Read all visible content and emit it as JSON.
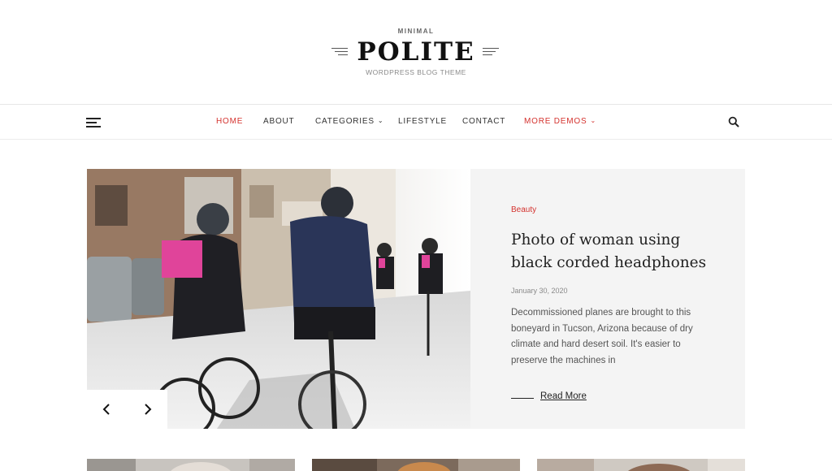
{
  "site": {
    "tagline": "MINIMAL",
    "title": "POLITE",
    "subtitle": "WORDPRESS BLOG THEME"
  },
  "nav": {
    "items": [
      {
        "label": "HOME",
        "active": true
      },
      {
        "label": "ABOUT"
      },
      {
        "label": "CATEGORIES",
        "dropdown": true
      },
      {
        "label": "LIFESTYLE"
      },
      {
        "label": "CONTACT"
      },
      {
        "label": "MORE DEMOS",
        "dropdown": true
      }
    ],
    "menu_icon": "hamburger-icon",
    "search_icon": "search-icon"
  },
  "featured": {
    "category": "Beauty",
    "title": "Photo of woman using black corded headphones",
    "date": "January 30, 2020",
    "excerpt": "Decommissioned planes are brought to this boneyard in Tucson, Arizona because of dry climate and hard desert soil. It's easier to preserve the machines in",
    "read_more": "Read More",
    "image_icon": "cyclists-photo",
    "prev_icon": "chevron-left-icon",
    "next_icon": "chevron-right-icon"
  },
  "colors": {
    "accent": "#d4322e",
    "panel": "#f4f4f4",
    "text": "#222222"
  }
}
